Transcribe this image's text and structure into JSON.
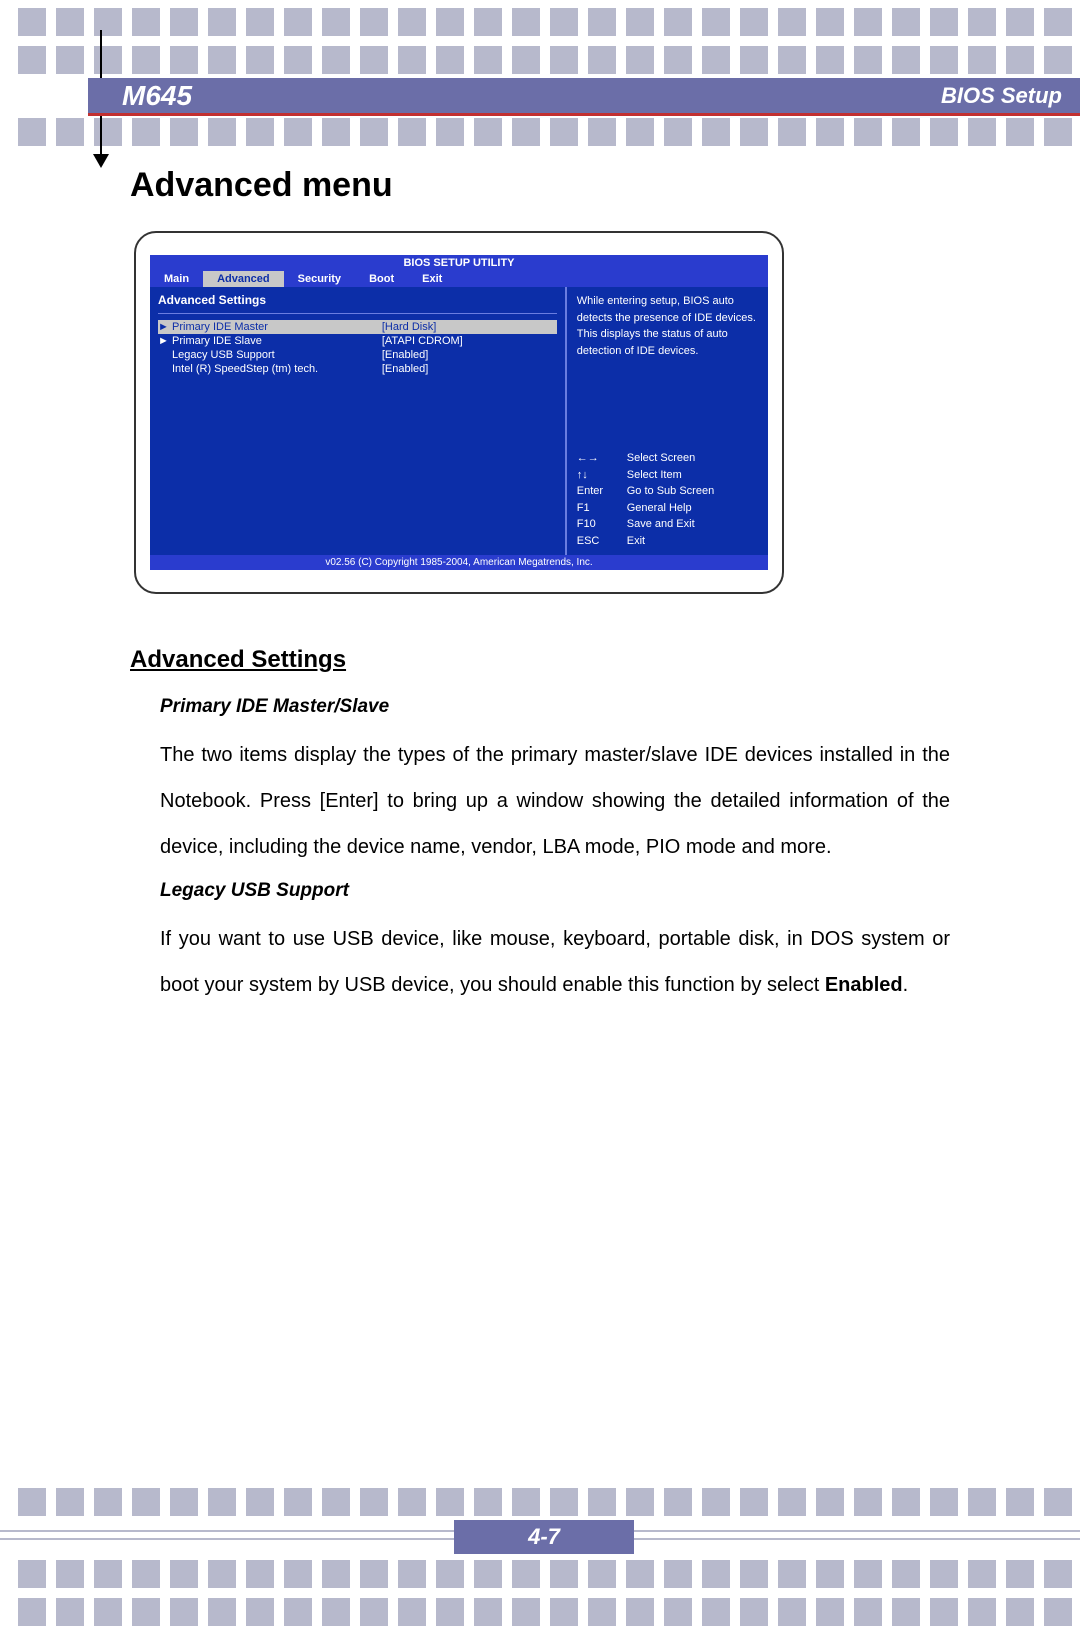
{
  "header": {
    "model": "M645",
    "section": "BIOS Setup"
  },
  "page_title": "Advanced menu",
  "bios": {
    "title": "BIOS SETUP UTILITY",
    "tabs": [
      "Main",
      "Advanced",
      "Security",
      "Boot",
      "Exit"
    ],
    "active_tab": "Advanced",
    "left_title": "Advanced Settings",
    "rows": [
      {
        "arrow": "►",
        "label": "Primary IDE Master",
        "value": "[Hard Disk]",
        "highlight": true
      },
      {
        "arrow": "►",
        "label": "Primary IDE Slave",
        "value": "[ATAPI CDROM]",
        "highlight": false
      },
      {
        "arrow": "",
        "label": "Legacy USB Support",
        "value": "[Enabled]",
        "highlight": false
      },
      {
        "arrow": "",
        "label": "Intel (R) SpeedStep (tm) tech.",
        "value": "[Enabled]",
        "highlight": false
      }
    ],
    "help_text": "While entering setup, BIOS auto detects the presence of IDE devices.  This displays the status of auto detection of IDE devices.",
    "keys": [
      {
        "k": "←→",
        "d": "Select Screen"
      },
      {
        "k": "↑↓",
        "d": "Select Item"
      },
      {
        "k": "Enter",
        "d": "Go to Sub Screen"
      },
      {
        "k": "F1",
        "d": "General Help"
      },
      {
        "k": "F10",
        "d": "Save and Exit"
      },
      {
        "k": "ESC",
        "d": "Exit"
      }
    ],
    "footer": "v02.56 (C) Copyright 1985-2004, American Megatrends, Inc."
  },
  "sections": {
    "heading": "Advanced Settings",
    "s1_title": "Primary IDE Master/Slave",
    "s1_body": "The two items display the types of the primary master/slave IDE devices installed in the Notebook.   Press [Enter] to bring up a window showing the detailed information of the device, including the device name, vendor, LBA mode, PIO mode and more.",
    "s2_title": "Legacy USB Support",
    "s2_body_pre": "If you want to use USB device, like mouse, keyboard, portable disk, in DOS system or boot your system by USB device, you should enable this function by select ",
    "s2_body_bold": "Enabled",
    "s2_body_post": "."
  },
  "page_number": "4-7"
}
